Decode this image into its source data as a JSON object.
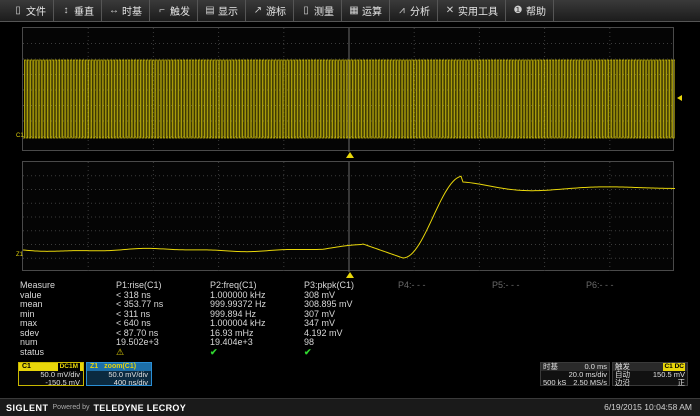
{
  "menu": [
    {
      "icon": "file-icon",
      "glyph": "▯",
      "label": "文件"
    },
    {
      "icon": "vertical-icon",
      "glyph": "↕",
      "label": "垂直"
    },
    {
      "icon": "timebase-icon",
      "glyph": "↔",
      "label": "时基"
    },
    {
      "icon": "trigger-icon",
      "glyph": "⌐",
      "label": "触发"
    },
    {
      "icon": "display-icon",
      "glyph": "▤",
      "label": "显示"
    },
    {
      "icon": "cursor-icon",
      "glyph": "↗",
      "label": "游标"
    },
    {
      "icon": "measure-icon",
      "glyph": "▯",
      "label": "测量"
    },
    {
      "icon": "math-icon",
      "glyph": "▦",
      "label": "运算"
    },
    {
      "icon": "analysis-icon",
      "glyph": "⩘",
      "label": "分析"
    },
    {
      "icon": "tools-icon",
      "glyph": "✕",
      "label": "实用工具"
    },
    {
      "icon": "help-icon",
      "glyph": "❶",
      "label": "帮助"
    }
  ],
  "channel_marks": {
    "top": "C1",
    "bottom": "Z1"
  },
  "colors": {
    "trace": "#e8d60a",
    "grid": "#3c3c3c",
    "check": "#2fd62f",
    "zoom": "#2a8fd6"
  },
  "measure": {
    "headers": [
      "Measure",
      "P1:rise(C1)",
      "P2:freq(C1)",
      "P3:pkpk(C1)",
      "P4:- - -",
      "P5:- - -",
      "P6:- - -"
    ],
    "rows": [
      {
        "label": "value",
        "p1": "< 318 ns",
        "p2": "1.000000 kHz",
        "p3": "308 mV"
      },
      {
        "label": "mean",
        "p1": "< 353.77 ns",
        "p2": "999.99372 Hz",
        "p3": "308.895 mV"
      },
      {
        "label": "min",
        "p1": "< 311 ns",
        "p2": "999.894 Hz",
        "p3": "307 mV"
      },
      {
        "label": "max",
        "p1": "< 640 ns",
        "p2": "1.000004 kHz",
        "p3": "347 mV"
      },
      {
        "label": "sdev",
        "p1": "< 87.70 ns",
        "p2": "16.93 mHz",
        "p3": "4.192 mV"
      },
      {
        "label": "num",
        "p1": "19.502e+3",
        "p2": "19.404e+3",
        "p3": "98"
      },
      {
        "label": "status",
        "p1": "⚠",
        "p2": "✔",
        "p3": "✔"
      }
    ]
  },
  "c1_box": {
    "title": "C1",
    "tag": "DC1M",
    "scale": "50.0 mV/div",
    "offset": "-150.5 mV"
  },
  "z1_box": {
    "title": "Z1",
    "name": "zoom(C1)",
    "scale": "50.0 mV/div",
    "time": "400 ns/div"
  },
  "timebase": {
    "label": "时基",
    "delay": "0.0 ms",
    "tdiv": "20.0 ms/div",
    "pts": "500 kS",
    "rate": "2.50 MS/s"
  },
  "trigger": {
    "label": "触发",
    "src": "C1 DC",
    "mode": "自动",
    "level": "150.5 mV",
    "type": "边沿",
    "slope": "正"
  },
  "footer": {
    "brand": "SIGLENT",
    "powered": "Powered by",
    "brand2": "TELEDYNE LECROY",
    "datetime": "6/19/2015 10:04:58 AM"
  }
}
